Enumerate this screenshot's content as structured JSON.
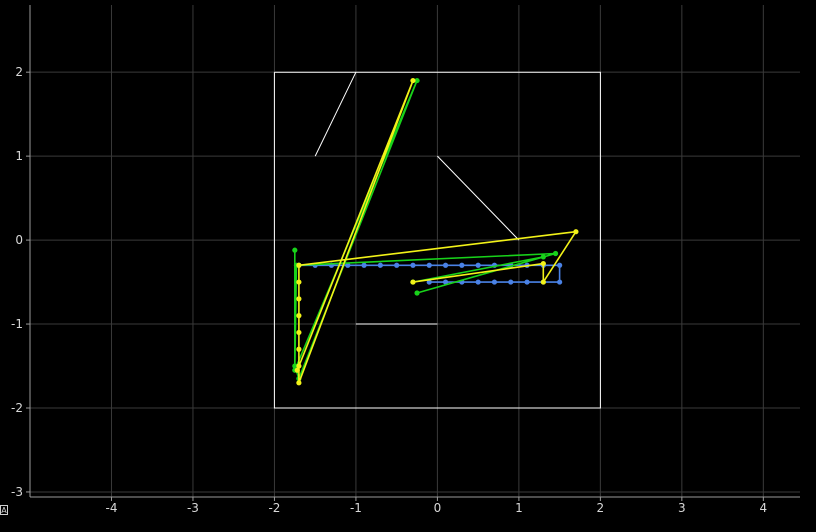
{
  "chart_data": {
    "type": "line",
    "title": "",
    "xlabel": "",
    "ylabel": "",
    "xlim": [
      -5,
      4.45
    ],
    "ylim": [
      -3.06,
      2.8
    ],
    "x_ticks": [
      -4,
      -3,
      -2,
      -1,
      0,
      1,
      2,
      3,
      4
    ],
    "y_ticks": [
      -3,
      -2,
      -1,
      0,
      1,
      2
    ],
    "grid": true,
    "legend": "none",
    "colors": {
      "background": "#000000",
      "grid": "#3a3a3a",
      "axes": "#9a9a9a",
      "box": "#ffffff",
      "blue": "#4a82e6",
      "green": "#18d21a",
      "yellow": "#f2f218"
    },
    "corner_button": "A",
    "series": [
      {
        "color": "#ffffff",
        "style": "plain",
        "segments": [
          [
            [
              -2,
              2
            ],
            [
              2,
              2
            ],
            [
              2,
              -2
            ],
            [
              -2,
              -2
            ],
            [
              -2,
              2
            ]
          ],
          [
            [
              -1.5,
              1
            ],
            [
              -1,
              2
            ]
          ],
          [
            [
              0,
              1
            ],
            [
              1,
              0
            ]
          ],
          [
            [
              -1,
              -1
            ],
            [
              0,
              -1
            ]
          ]
        ]
      },
      {
        "color": "#4a82e6",
        "style": "markers",
        "points": [
          [
            -1.7,
            -0.3
          ],
          [
            -1.5,
            -0.3
          ],
          [
            -1.3,
            -0.3
          ],
          [
            -1.1,
            -0.3
          ],
          [
            -0.9,
            -0.3
          ],
          [
            -0.7,
            -0.3
          ],
          [
            -0.5,
            -0.3
          ],
          [
            -0.3,
            -0.3
          ],
          [
            -0.1,
            -0.3
          ],
          [
            0.1,
            -0.3
          ],
          [
            0.3,
            -0.3
          ],
          [
            0.5,
            -0.3
          ],
          [
            0.7,
            -0.3
          ],
          [
            0.9,
            -0.3
          ],
          [
            1.1,
            -0.3
          ],
          [
            1.3,
            -0.3
          ],
          [
            1.5,
            -0.3
          ],
          [
            1.5,
            -0.5
          ],
          [
            1.3,
            -0.5
          ],
          [
            1.1,
            -0.5
          ],
          [
            0.9,
            -0.5
          ],
          [
            0.7,
            -0.5
          ],
          [
            0.5,
            -0.5
          ],
          [
            0.3,
            -0.5
          ],
          [
            0.1,
            -0.5
          ],
          [
            -0.1,
            -0.5
          ]
        ]
      },
      {
        "color": "#18d21a",
        "style": "markers",
        "points": [
          [
            -1.75,
            -0.12
          ],
          [
            -1.75,
            -1.5
          ],
          [
            -1.7,
            -1.65
          ],
          [
            -0.25,
            1.9
          ],
          [
            -1.75,
            -1.55
          ],
          [
            -1.73,
            -0.3
          ],
          [
            1.45,
            -0.16
          ],
          [
            -0.25,
            -0.63
          ],
          [
            1.3,
            -0.2
          ],
          [
            -0.3,
            -0.5
          ]
        ]
      },
      {
        "color": "#f2f218",
        "style": "markers",
        "points": [
          [
            -0.3,
            -0.5
          ],
          [
            1.3,
            -0.28
          ],
          [
            1.3,
            -0.5
          ],
          [
            1.7,
            0.1
          ],
          [
            -1.7,
            -0.3
          ],
          [
            -1.7,
            -0.5
          ],
          [
            -1.7,
            -0.7
          ],
          [
            -1.7,
            -0.9
          ],
          [
            -1.7,
            -1.1
          ],
          [
            -1.7,
            -1.3
          ],
          [
            -1.7,
            -1.5
          ],
          [
            -1.7,
            -1.7
          ],
          [
            -0.3,
            1.9
          ],
          [
            -1.72,
            -1.55
          ]
        ]
      }
    ]
  }
}
